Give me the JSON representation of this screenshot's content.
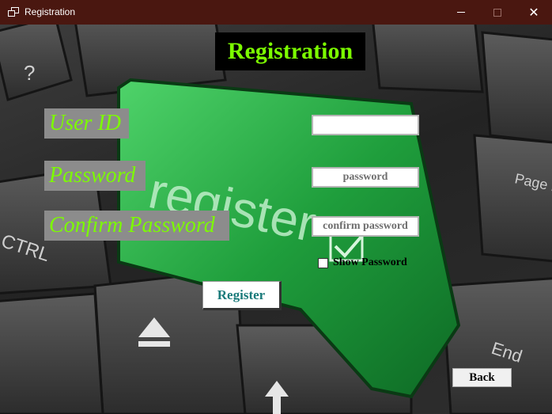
{
  "window": {
    "title": "Registration",
    "minimize_icon": "minimize-icon",
    "maximize_icon": "maximize-icon",
    "close_icon": "close-icon",
    "close_glyph": "✕"
  },
  "background": {
    "image": "keyboard-register-key",
    "key_text": "register",
    "key_glyphs": [
      "?",
      "CTRL",
      "Page Down",
      "End"
    ],
    "accent_color": "#2fb34a"
  },
  "form": {
    "heading": "Registration",
    "user_id_label": "User ID",
    "password_label": "Password",
    "confirm_password_label": "Confirm Password",
    "user_id_value": "",
    "password_value": "password",
    "confirm_password_value": "confirm password",
    "show_password_label": "Show Password",
    "show_password_checked": false,
    "register_label": "Register",
    "back_label": "Back"
  },
  "colors": {
    "titlebar": "#4a1710",
    "heading_bg": "#000000",
    "heading_text": "#7cfc00",
    "label_bg": "#8c8c8c",
    "label_text": "#7cfc00",
    "register_text": "#1a7a7a"
  }
}
